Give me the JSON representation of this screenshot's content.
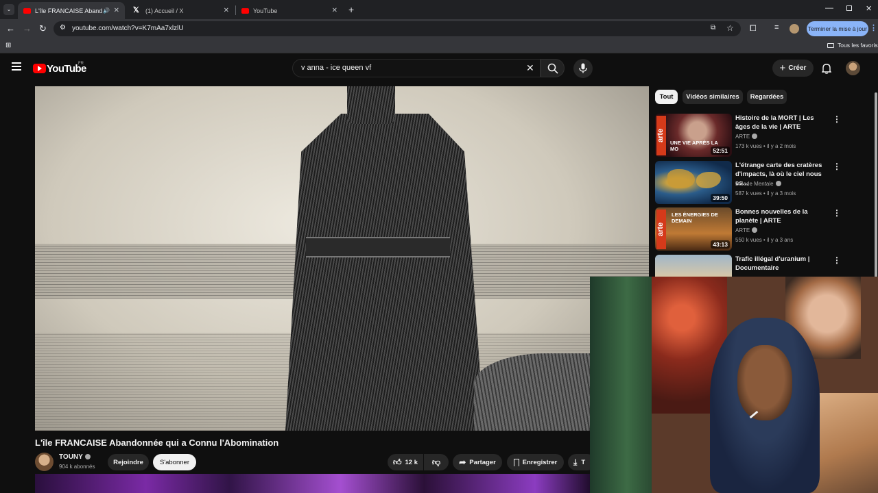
{
  "browser": {
    "tabs": [
      {
        "title": "L'île FRANCAISE Abandonnée qui a Connu l'Abomination",
        "favicon": "youtube-icon",
        "active": true,
        "audio": true
      },
      {
        "title": "(1) Accueil / X",
        "favicon": "x-icon",
        "active": false
      },
      {
        "title": "YouTube",
        "favicon": "youtube-icon",
        "active": false
      }
    ],
    "url": "youtube.com/watch?v=K7mAa7xlzlU",
    "update_button": "Terminer la mise à jour",
    "bookmarks_label": "Tous les favoris"
  },
  "youtube": {
    "logo": "YouTube",
    "region": "FR",
    "search_query": "v anna - ice queen vf",
    "create_label": "Créer",
    "video": {
      "title": "L'île FRANCAISE Abandonnée qui a Connu l'Abomination",
      "channel": "TOUNY",
      "subscribers": "904 k abonnés",
      "join_label": "Rejoindre",
      "subscribe_label": "S'abonner",
      "likes": "12 k",
      "share_label": "Partager",
      "save_label": "Enregistrer",
      "download_label": "T"
    },
    "chips": [
      "Tout",
      "Vidéos similaires",
      "Regardées"
    ],
    "recommendations": [
      {
        "title": "Histoire de la MORT | Les âges de la vie | ARTE",
        "channel": "ARTE",
        "views": "173 k vues",
        "age": "il y a 2 mois",
        "duration": "52:51",
        "overlay": "UNE VIE APRÈS LA MO"
      },
      {
        "title": "L'étrange carte des cratères d'impacts, là où le ciel nous es...",
        "channel": "Balade Mentale",
        "views": "587 k vues",
        "age": "il y a 3 mois",
        "duration": "39:50",
        "overlay": ""
      },
      {
        "title": "Bonnes nouvelles de la planète | ARTE",
        "channel": "ARTE",
        "views": "550 k vues",
        "age": "il y a 3 ans",
        "duration": "43:13",
        "overlay": "LES ÉNERGIES DE DEMAIN"
      },
      {
        "title": "Trafic illégal d'uranium | Documentaire",
        "channel": "",
        "views": "",
        "age": "",
        "duration": "",
        "overlay": ""
      }
    ],
    "arte_mark": "arte"
  },
  "colors": {
    "youtube_red": "#ff0000",
    "update_blue": "#8ab4f8",
    "background": "#0f0f0f"
  }
}
